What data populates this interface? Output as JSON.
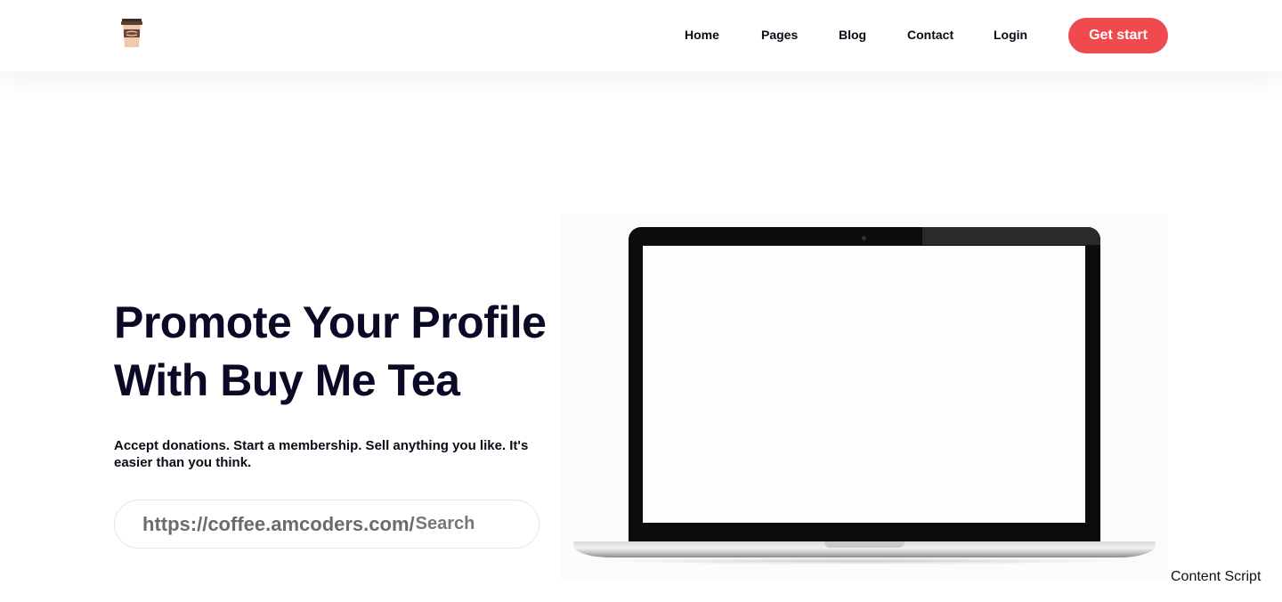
{
  "header": {
    "logo_icon": "coffee-cup-icon",
    "nav": [
      {
        "label": "Home"
      },
      {
        "label": "Pages"
      },
      {
        "label": "Blog"
      },
      {
        "label": "Contact"
      },
      {
        "label": "Login"
      }
    ],
    "cta_label": "Get start"
  },
  "hero": {
    "title_line1": "Promote Your Profile",
    "title_line2": "With Buy Me Tea",
    "subtitle": "Accept donations. Start a membership. Sell anything you like. It's easier than you think.",
    "url_prefix": "https://coffee.amcoders.com/",
    "search_placeholder": "Search",
    "image_icon": "laptop-icon"
  },
  "overlay": {
    "content_script_label": "Content Script"
  },
  "colors": {
    "accent": "#ef4b4f",
    "heading": "#0a0a26",
    "text": "#0b0b16",
    "muted": "#6b6b6b"
  }
}
